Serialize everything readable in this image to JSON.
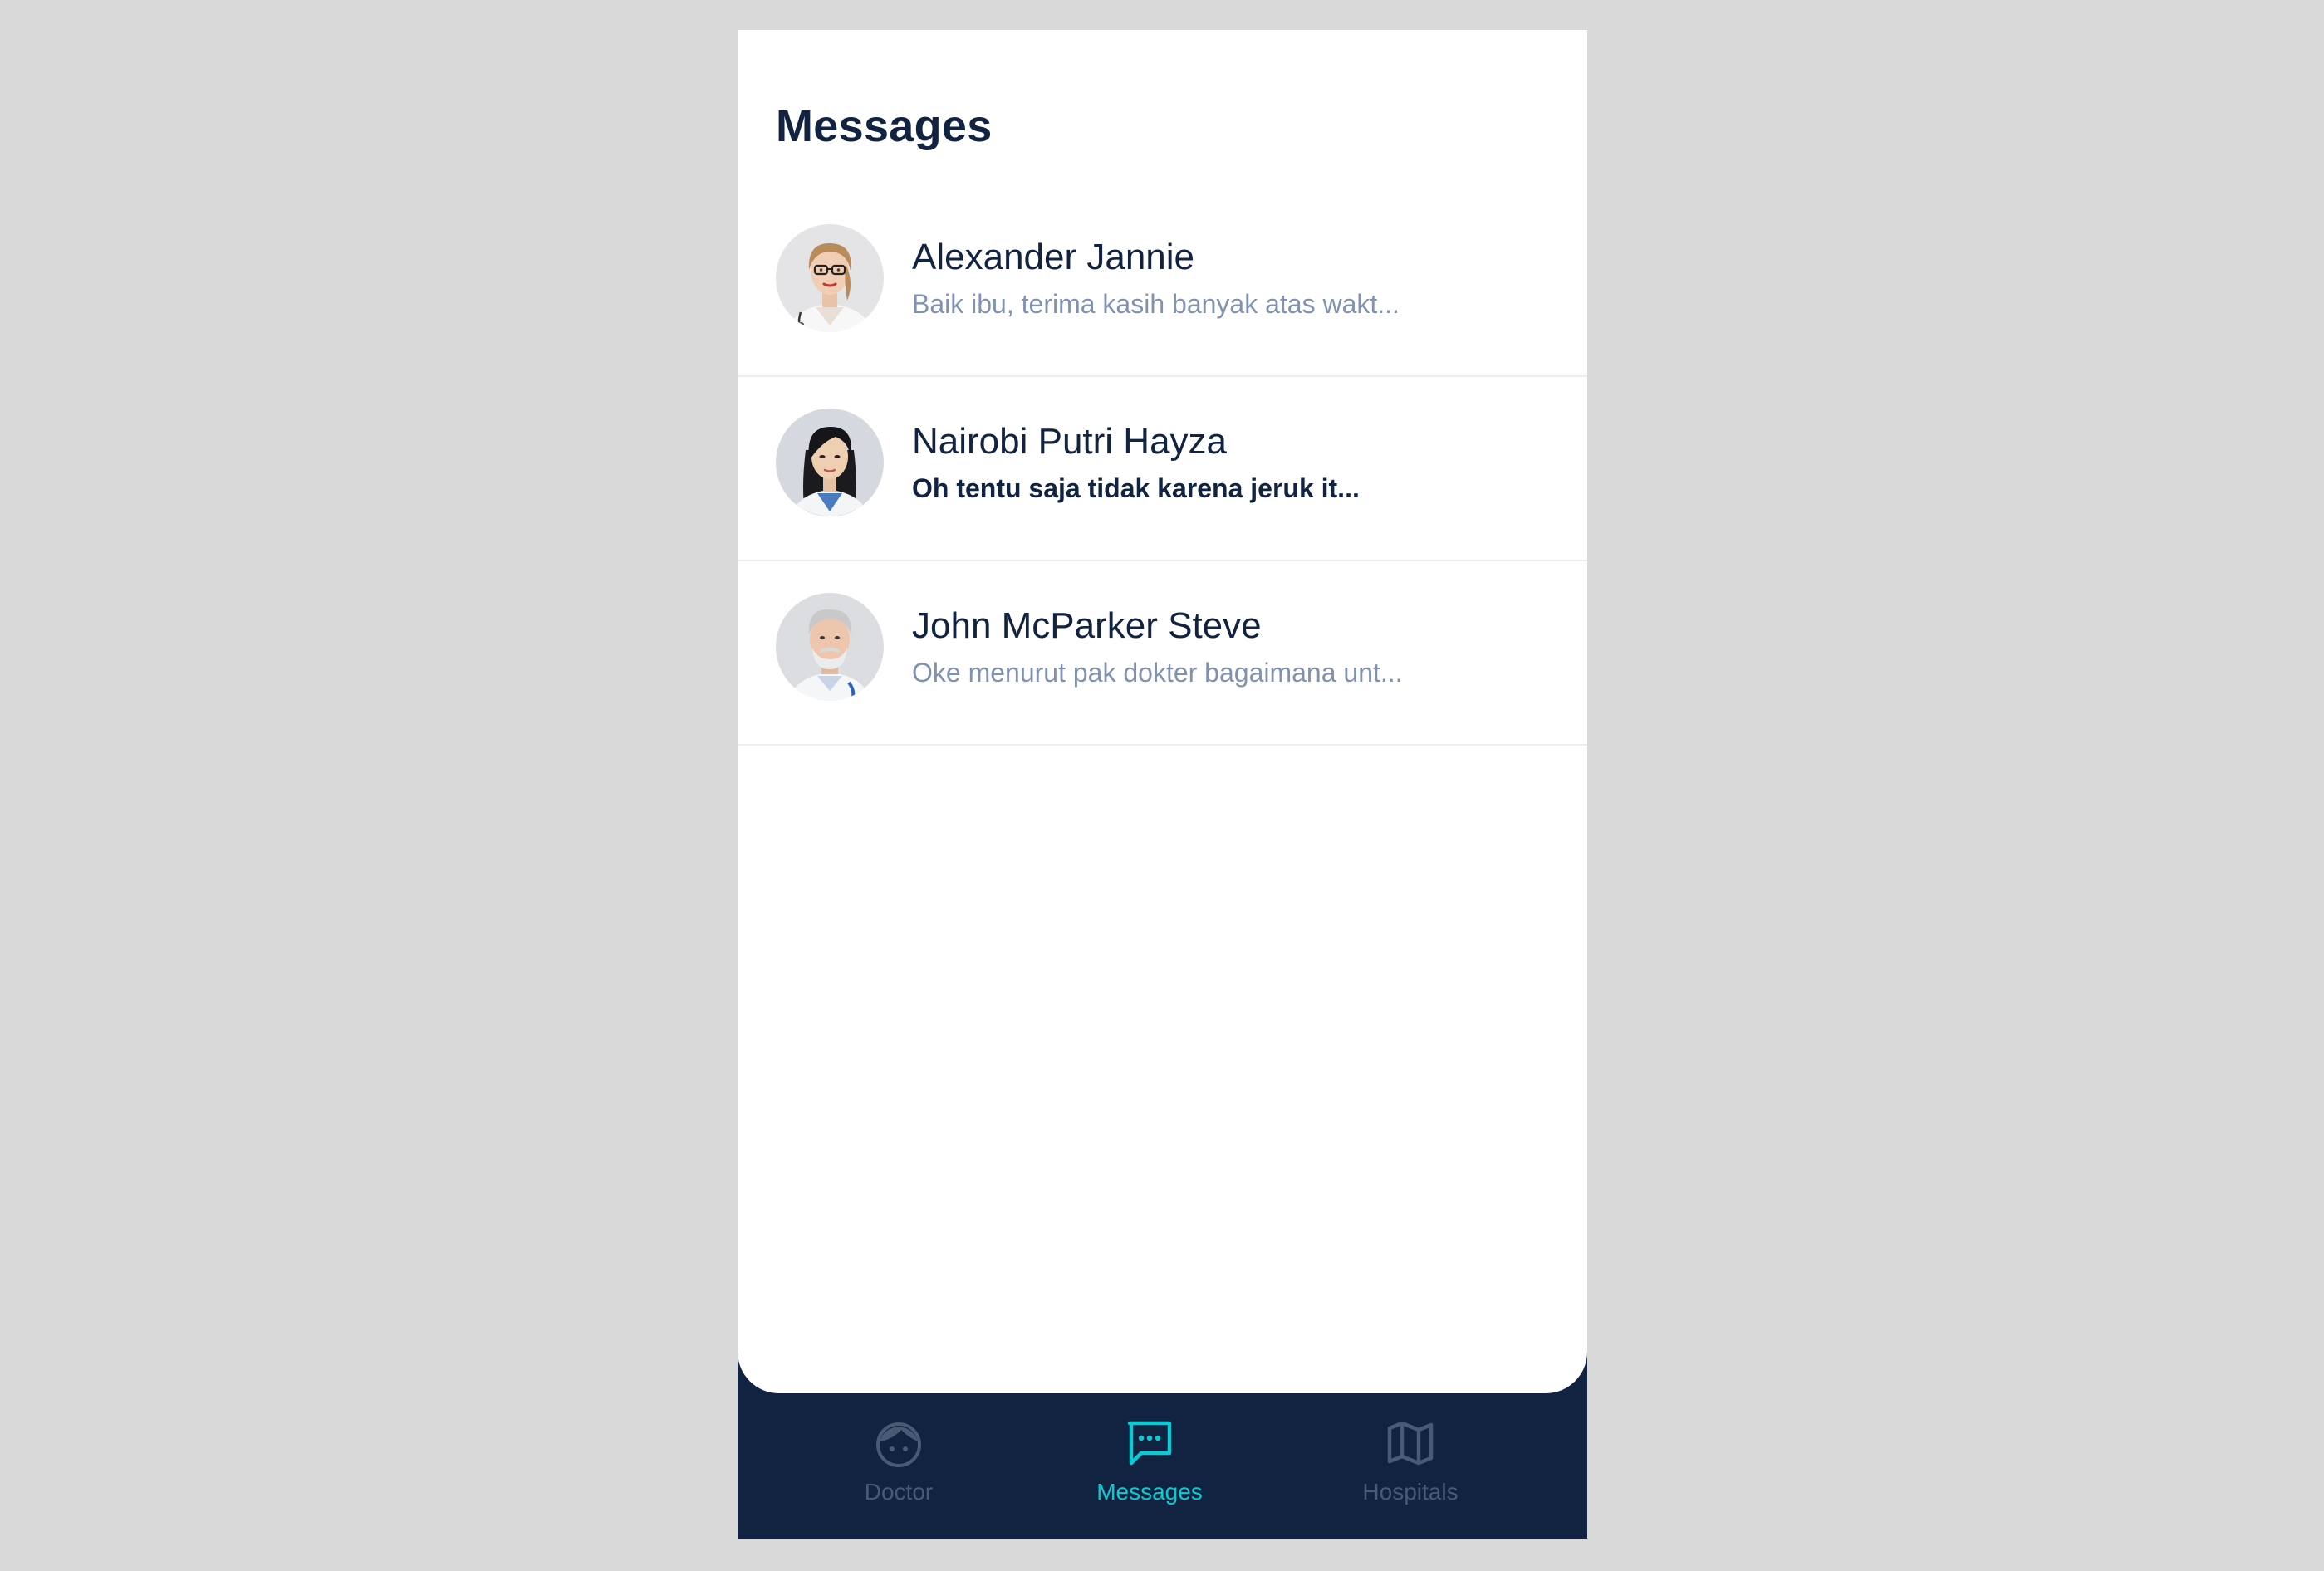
{
  "page": {
    "title": "Messages"
  },
  "chats": [
    {
      "name": "Alexander Jannie",
      "preview": "Baik ibu, terima kasih banyak atas wakt...",
      "unread": false,
      "avatar": "female-doctor-glasses-photo"
    },
    {
      "name": "Nairobi Putri Hayza",
      "preview": "Oh tentu saja tidak karena jeruk it...",
      "unread": true,
      "avatar": "female-doctor-photo"
    },
    {
      "name": "John McParker Steve",
      "preview": "Oke menurut pak dokter bagaimana unt...",
      "unread": false,
      "avatar": "male-doctor-photo"
    }
  ],
  "tabs": [
    {
      "label": "Doctor",
      "icon": "doctor-face-icon",
      "active": false
    },
    {
      "label": "Messages",
      "icon": "chat-bubble-icon",
      "active": true
    },
    {
      "label": "Hospitals",
      "icon": "map-icon",
      "active": false
    }
  ],
  "colors": {
    "background": "#d9d9d9",
    "screen": "#ffffff",
    "primary_dark": "#112340",
    "accent": "#0bcad4",
    "text_secondary": "#8092af",
    "tab_inactive": "#495a75",
    "divider": "#eeeeee"
  }
}
